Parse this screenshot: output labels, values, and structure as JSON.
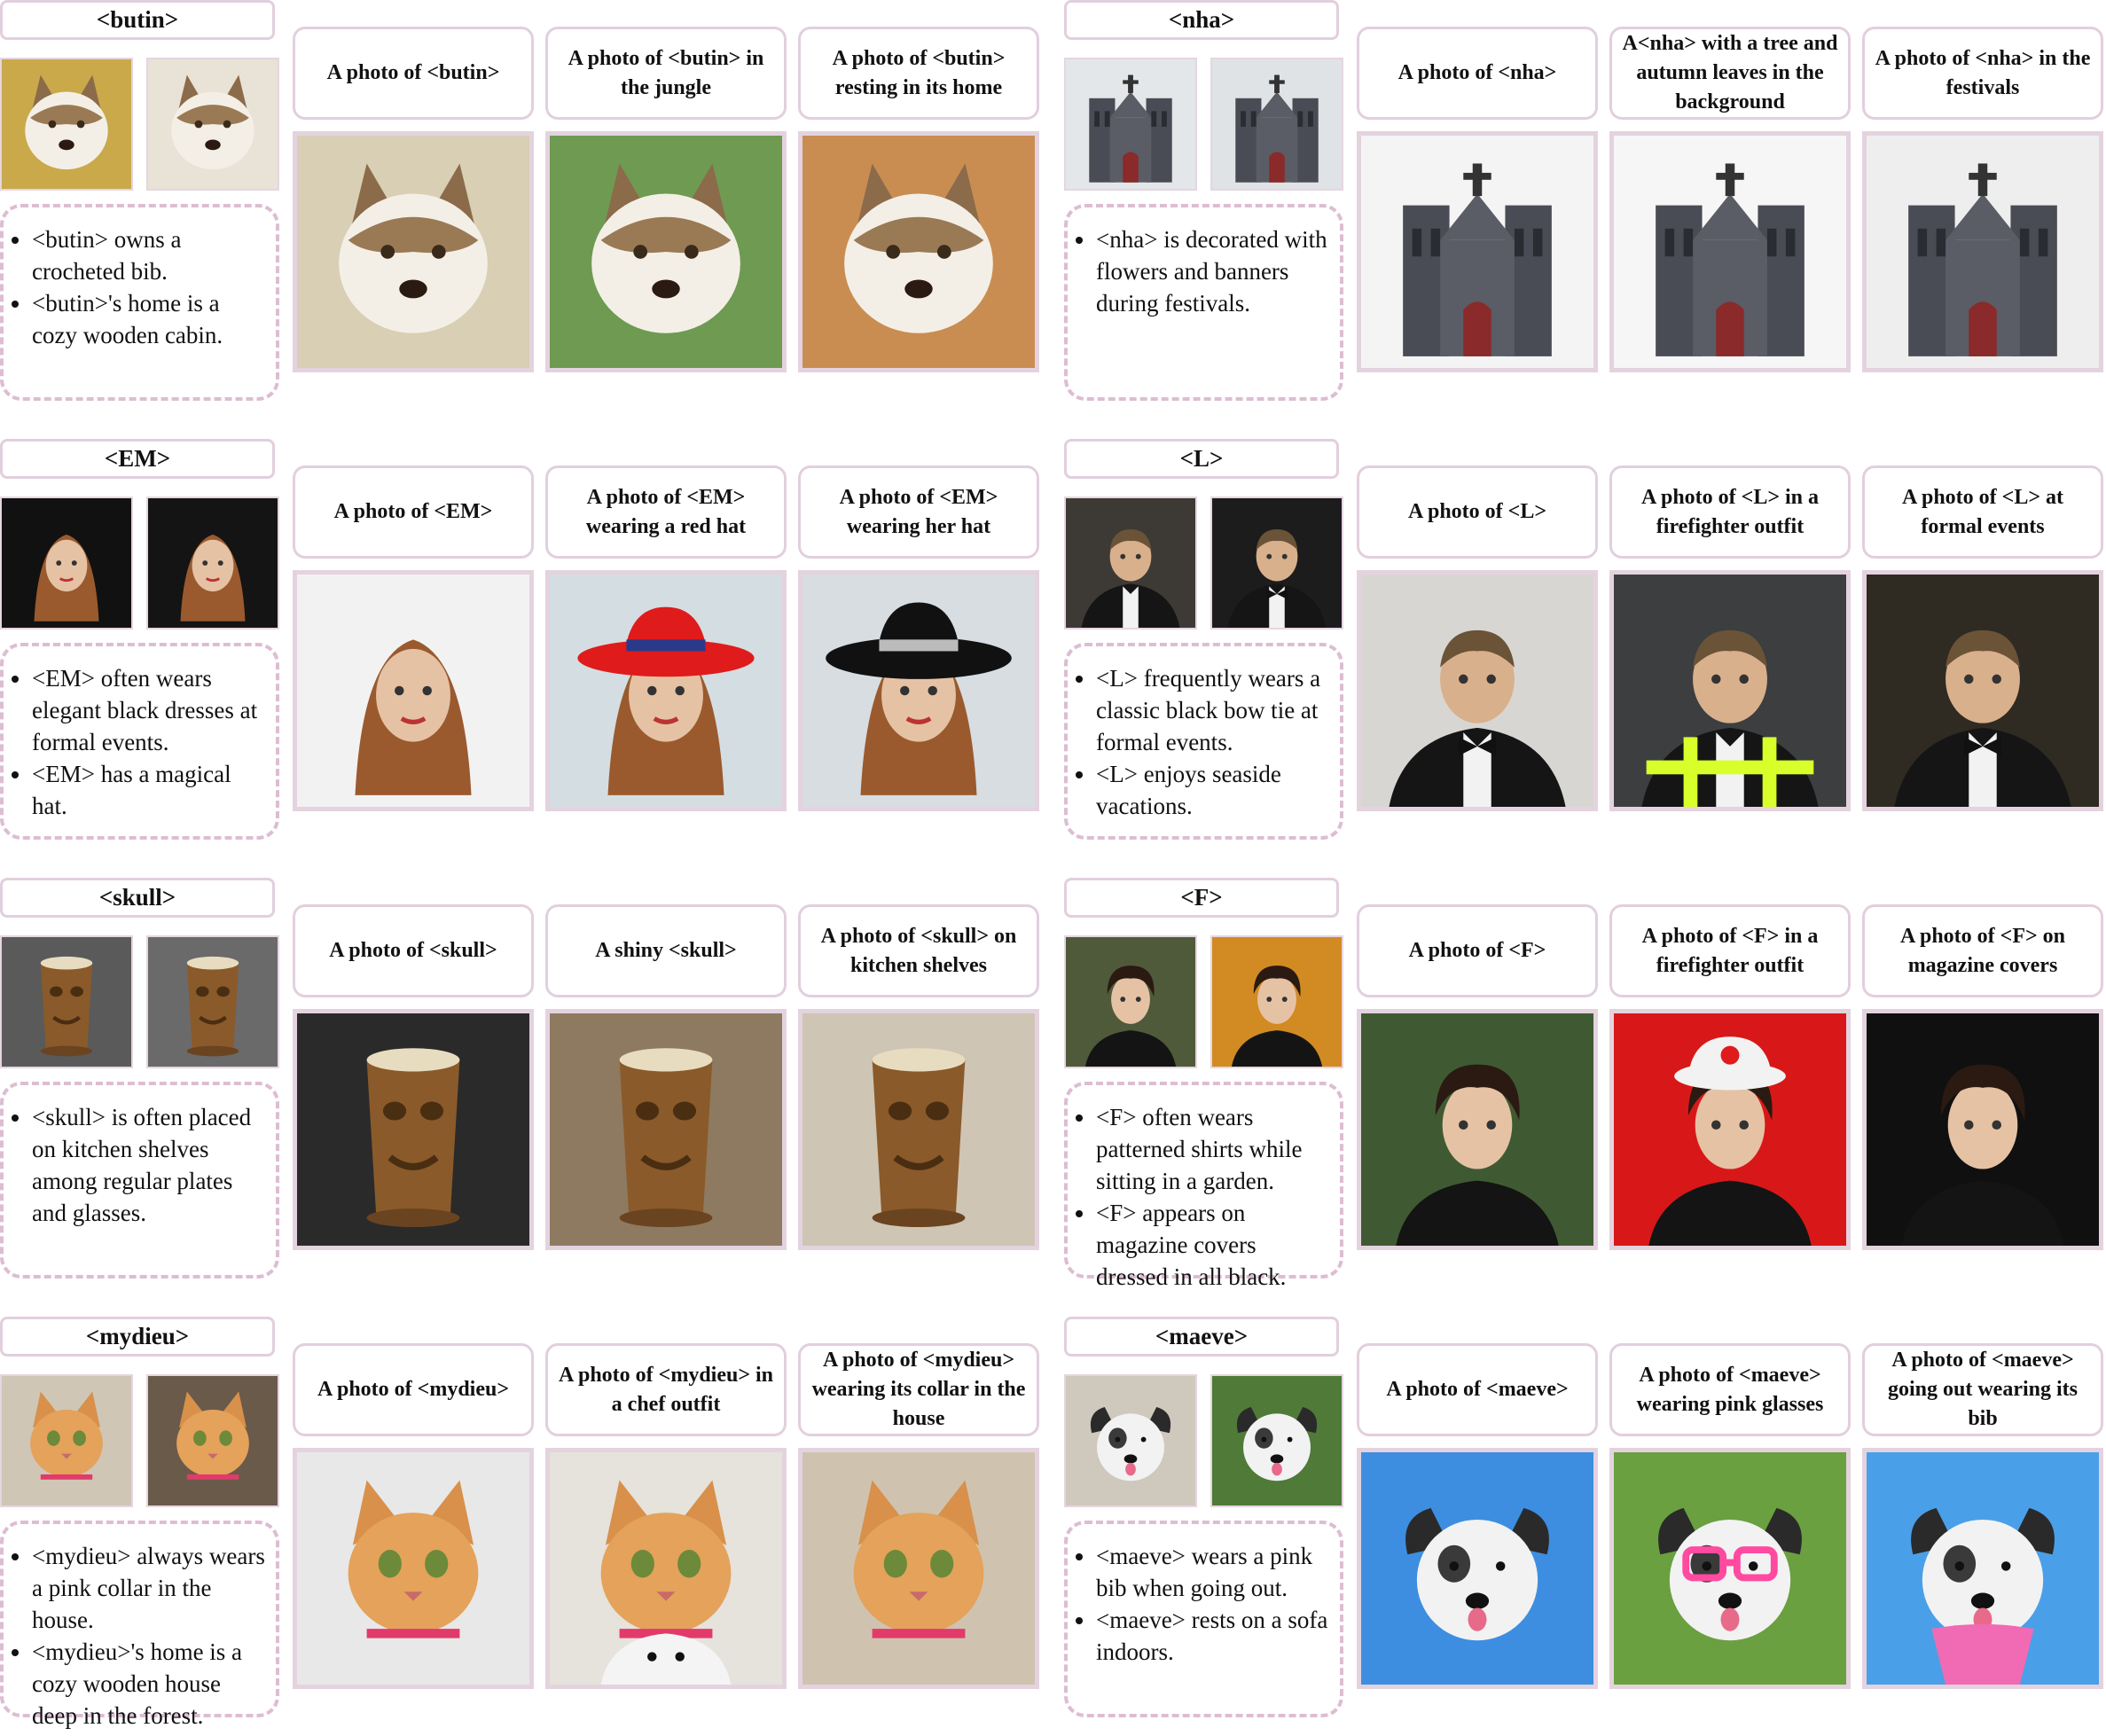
{
  "blocks": [
    {
      "title": "<butin>",
      "notes": [
        "<butin> owns a crocheted bib.",
        "<butin>'s home is a cozy wooden cabin."
      ],
      "prompts": [
        "A photo of  <butin>",
        "A photo of  <butin> in the jungle",
        "A photo of  <butin> resting in its home"
      ],
      "ref_images": [
        {
          "icon": "husky-photo",
          "bg": "#c9a94a"
        },
        {
          "icon": "husky-photo",
          "bg": "#e9e2d6"
        }
      ],
      "gen_images": [
        {
          "icon": "husky-photo",
          "bg": "#d8cfb4"
        },
        {
          "icon": "husky-photo",
          "bg": "#6e9a52"
        },
        {
          "icon": "husky-photo",
          "bg": "#c98d52"
        }
      ]
    },
    {
      "title": "<nha>",
      "notes": [
        "<nha> is decorated with flowers and banners during festivals."
      ],
      "prompts": [
        "A photo of  <nha>",
        "A<nha> with a tree and autumn leaves in the background",
        "A photo of  <nha> in the festivals"
      ],
      "ref_images": [
        {
          "icon": "cathedral-photo",
          "bg": "#e3e7ea"
        },
        {
          "icon": "cathedral-photo",
          "bg": "#dfe3e6"
        }
      ],
      "gen_images": [
        {
          "icon": "cathedral-photo",
          "bg": "#f4f4f4"
        },
        {
          "icon": "cathedral-photo",
          "bg": "#f6f6f6"
        },
        {
          "icon": "cathedral-photo",
          "bg": "#eeeeee"
        }
      ]
    },
    {
      "title": "<EM>",
      "notes": [
        "<EM> often wears elegant black dresses at formal events.",
        "<EM> has a magical hat."
      ],
      "prompts": [
        "A photo of  <EM>",
        "A photo of  <EM> wearing a red hat",
        "A photo of  <EM> wearing her hat"
      ],
      "ref_images": [
        {
          "icon": "woman-photo",
          "bg": "#111111"
        },
        {
          "icon": "woman-photo",
          "bg": "#141414"
        }
      ],
      "gen_images": [
        {
          "icon": "woman-photo",
          "bg": "#f2f2f2"
        },
        {
          "icon": "woman-red-hat-photo",
          "bg": "#d4dde2"
        },
        {
          "icon": "woman-black-hat-photo",
          "bg": "#d7dde1"
        }
      ]
    },
    {
      "title": "<L>",
      "notes": [
        "<L> frequently wears a classic black bow tie at formal events.",
        "<L> enjoys seaside vacations."
      ],
      "prompts": [
        "A photo of  <L>",
        "A photo of <L> in a firefighter outfit",
        "A photo of  <L> at formal events"
      ],
      "ref_images": [
        {
          "icon": "man-photo",
          "bg": "#3d3a36"
        },
        {
          "icon": "man-tuxedo-photo",
          "bg": "#1c1c1c"
        }
      ],
      "gen_images": [
        {
          "icon": "man-tuxedo-photo",
          "bg": "#d8d6d2"
        },
        {
          "icon": "man-firefighter-photo",
          "bg": "#3c3e40"
        },
        {
          "icon": "man-tuxedo-photo",
          "bg": "#2f2a22"
        }
      ]
    },
    {
      "title": "<skull>",
      "notes": [
        "<skull> is often placed on kitchen shelves among regular plates and glasses."
      ],
      "prompts": [
        "A photo of  <skull>",
        "A shiny  <skull>",
        "A photo of  <skull> on kitchen shelves"
      ],
      "ref_images": [
        {
          "icon": "tiki-mug-photo",
          "bg": "#5a5a5a"
        },
        {
          "icon": "tiki-mug-photo",
          "bg": "#6a6a6a"
        }
      ],
      "gen_images": [
        {
          "icon": "tiki-mug-photo",
          "bg": "#2a2a2a"
        },
        {
          "icon": "tiki-mug-photo",
          "bg": "#8d7a60"
        },
        {
          "icon": "tiki-mug-photo",
          "bg": "#cfc5b4"
        }
      ]
    },
    {
      "title": "<F>",
      "notes": [
        "<F> often wears patterned shirts while sitting in a garden.",
        "<F> appears on magazine covers dressed in all black."
      ],
      "prompts": [
        "A photo of  <F>",
        "A photo of <F> in a firefighter outfit",
        "A photo of  <F> on magazine covers"
      ],
      "ref_images": [
        {
          "icon": "young-man-photo",
          "bg": "#4e5a3a"
        },
        {
          "icon": "young-man-photo",
          "bg": "#d28a22"
        }
      ],
      "gen_images": [
        {
          "icon": "young-man-photo",
          "bg": "#3f5a32"
        },
        {
          "icon": "young-man-firefighter-photo",
          "bg": "#d81818"
        },
        {
          "icon": "young-man-photo",
          "bg": "#101010"
        }
      ]
    },
    {
      "title": "<mydieu>",
      "notes": [
        "<mydieu> always wears a pink collar in the house.",
        "<mydieu>'s home is a cozy wooden house deep in the forest."
      ],
      "prompts": [
        "A photo of  <mydieu>",
        "A photo of  <mydieu> in a chef outfit",
        "A photo of  <mydieu> wearing its collar in the house"
      ],
      "ref_images": [
        {
          "icon": "cat-photo",
          "bg": "#cfc6b6"
        },
        {
          "icon": "cat-photo",
          "bg": "#6a5a4a"
        }
      ],
      "gen_images": [
        {
          "icon": "cat-photo",
          "bg": "#e8e8e8"
        },
        {
          "icon": "cat-chef-photo",
          "bg": "#e6e2dc"
        },
        {
          "icon": "cat-photo",
          "bg": "#cfc3b0"
        }
      ]
    },
    {
      "title": "<maeve>",
      "notes": [
        "<maeve> wears a pink bib when going out.",
        "<maeve> rests on a sofa indoors."
      ],
      "prompts": [
        "A photo of <maeve>",
        "A photo of <maeve> wearing pink glasses",
        "A photo of <maeve> going out wearing its bib"
      ],
      "ref_images": [
        {
          "icon": "dog-photo",
          "bg": "#cfc8bc"
        },
        {
          "icon": "dog-photo",
          "bg": "#4f7a38"
        }
      ],
      "gen_images": [
        {
          "icon": "dog-photo",
          "bg": "#3d8ee0"
        },
        {
          "icon": "dog-pink-glasses-photo",
          "bg": "#6aa040"
        },
        {
          "icon": "dog-pink-bib-photo",
          "bg": "#4aa0e8"
        }
      ]
    }
  ]
}
